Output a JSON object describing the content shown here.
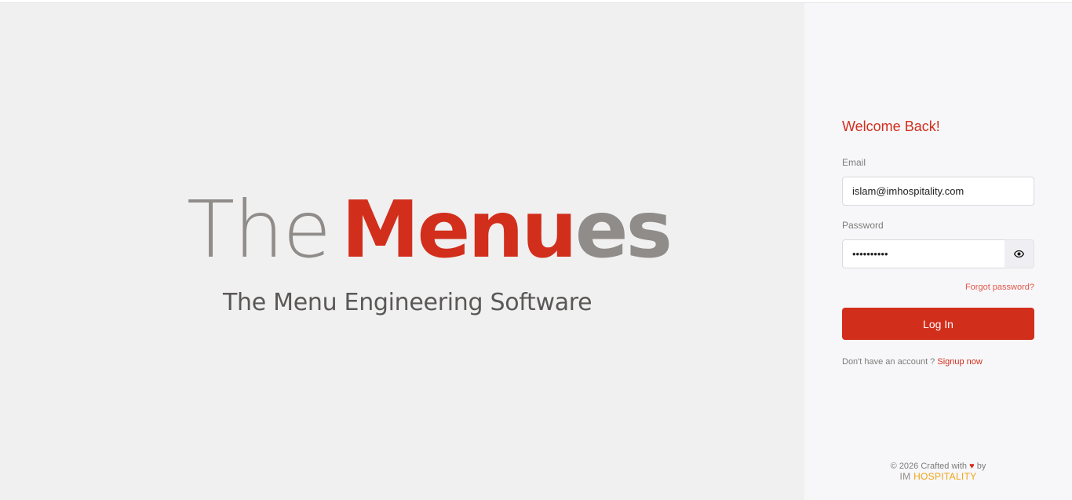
{
  "logo": {
    "part_the": "The",
    "part_menu": "Menu",
    "part_es": "es"
  },
  "tagline": "The Menu Engineering Software",
  "login": {
    "welcome": "Welcome Back!",
    "email_label": "Email",
    "email_value": "islam@imhospitality.com",
    "password_label": "Password",
    "password_value": "••••••••••",
    "forgot_password": "Forgot password?",
    "login_button": "Log In",
    "signup_prompt": "Don't have an account ?",
    "signup_link": "Signup now"
  },
  "footer": {
    "crafted_prefix": "© 2026 Crafted with",
    "heart": "♥",
    "crafted_suffix": "by",
    "brand_im": "IM",
    "brand_hospitality": "HOSPITALITY"
  },
  "icons": {
    "password_toggle": "eye-icon",
    "heart": "heart-icon"
  },
  "colors": {
    "accent": "#d22e1c",
    "logo_gray": "#8f8c89",
    "brand_orange": "#f0a418"
  }
}
